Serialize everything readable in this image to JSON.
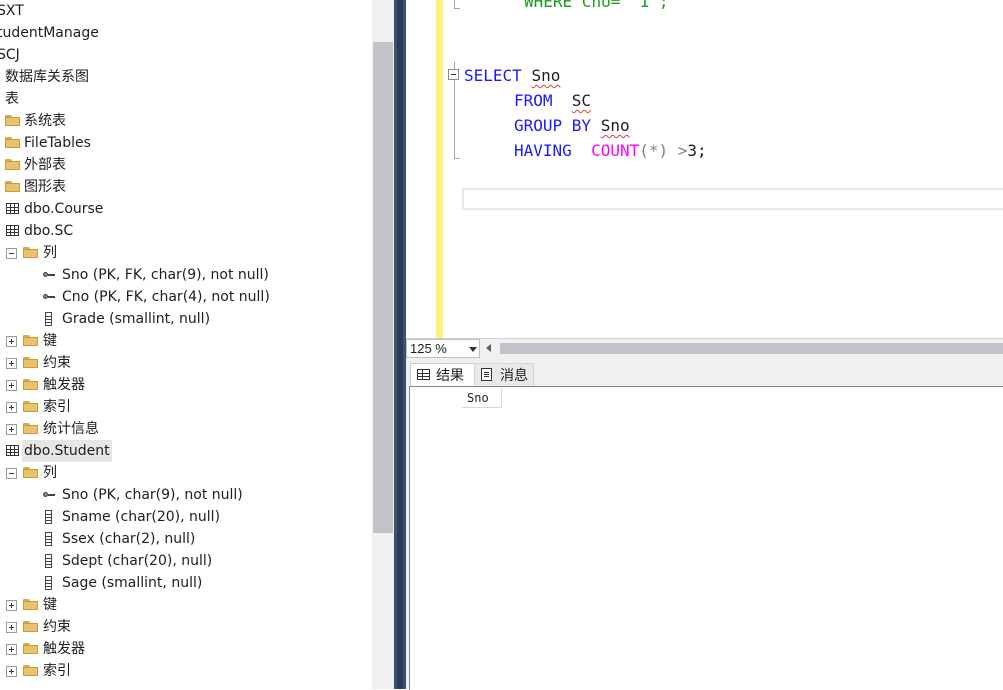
{
  "object_explorer": {
    "nodes": [
      {
        "label": "SXT"
      },
      {
        "label": "tudentManage"
      },
      {
        "label": "SCJ"
      },
      {
        "label": "数据库关系图"
      },
      {
        "label": "表"
      },
      {
        "label": "系统表"
      },
      {
        "label": "FileTables"
      },
      {
        "label": "外部表"
      },
      {
        "label": "图形表"
      },
      {
        "label": "dbo.Course"
      },
      {
        "label": "dbo.SC"
      },
      {
        "label": "列"
      },
      {
        "label": "Sno (PK, FK, char(9), not null)"
      },
      {
        "label": "Cno (PK, FK, char(4), not null)"
      },
      {
        "label": "Grade (smallint, null)"
      },
      {
        "label": "键"
      },
      {
        "label": "约束"
      },
      {
        "label": "触发器"
      },
      {
        "label": "索引"
      },
      {
        "label": "统计信息"
      },
      {
        "label": "dbo.Student"
      },
      {
        "label": "列"
      },
      {
        "label": "Sno (PK, char(9), not null)"
      },
      {
        "label": "Sname (char(20), null)"
      },
      {
        "label": "Ssex (char(2), null)"
      },
      {
        "label": "Sdept (char(20), null)"
      },
      {
        "label": "Sage (smallint, null)"
      },
      {
        "label": "键"
      },
      {
        "label": "约束"
      },
      {
        "label": "触发器"
      },
      {
        "label": "索引"
      }
    ]
  },
  "editor": {
    "partial_line": {
      "kw": "WHERE",
      "rest": " Cno= '1';"
    },
    "query": {
      "l1_kw": "SELECT",
      "l1_ident": "Sno",
      "l2_kw": "FROM",
      "l2_ident": "SC",
      "l3_kw": "GROUP BY",
      "l3_ident": "Sno",
      "l4_kw": "HAVING",
      "l4_fn": "COUNT",
      "l4_args": "(*)",
      "l4_op": ">",
      "l4_rest": "3;"
    },
    "zoom": "125 %"
  },
  "results": {
    "tab_results": "结果",
    "tab_messages": "消息",
    "column_header": "Sno"
  },
  "colors": {
    "keyword": "#1a1aff",
    "function": "#ff00ff",
    "operator": "#808080",
    "margin": "#fff17a",
    "divider": "#3f4f6d"
  }
}
